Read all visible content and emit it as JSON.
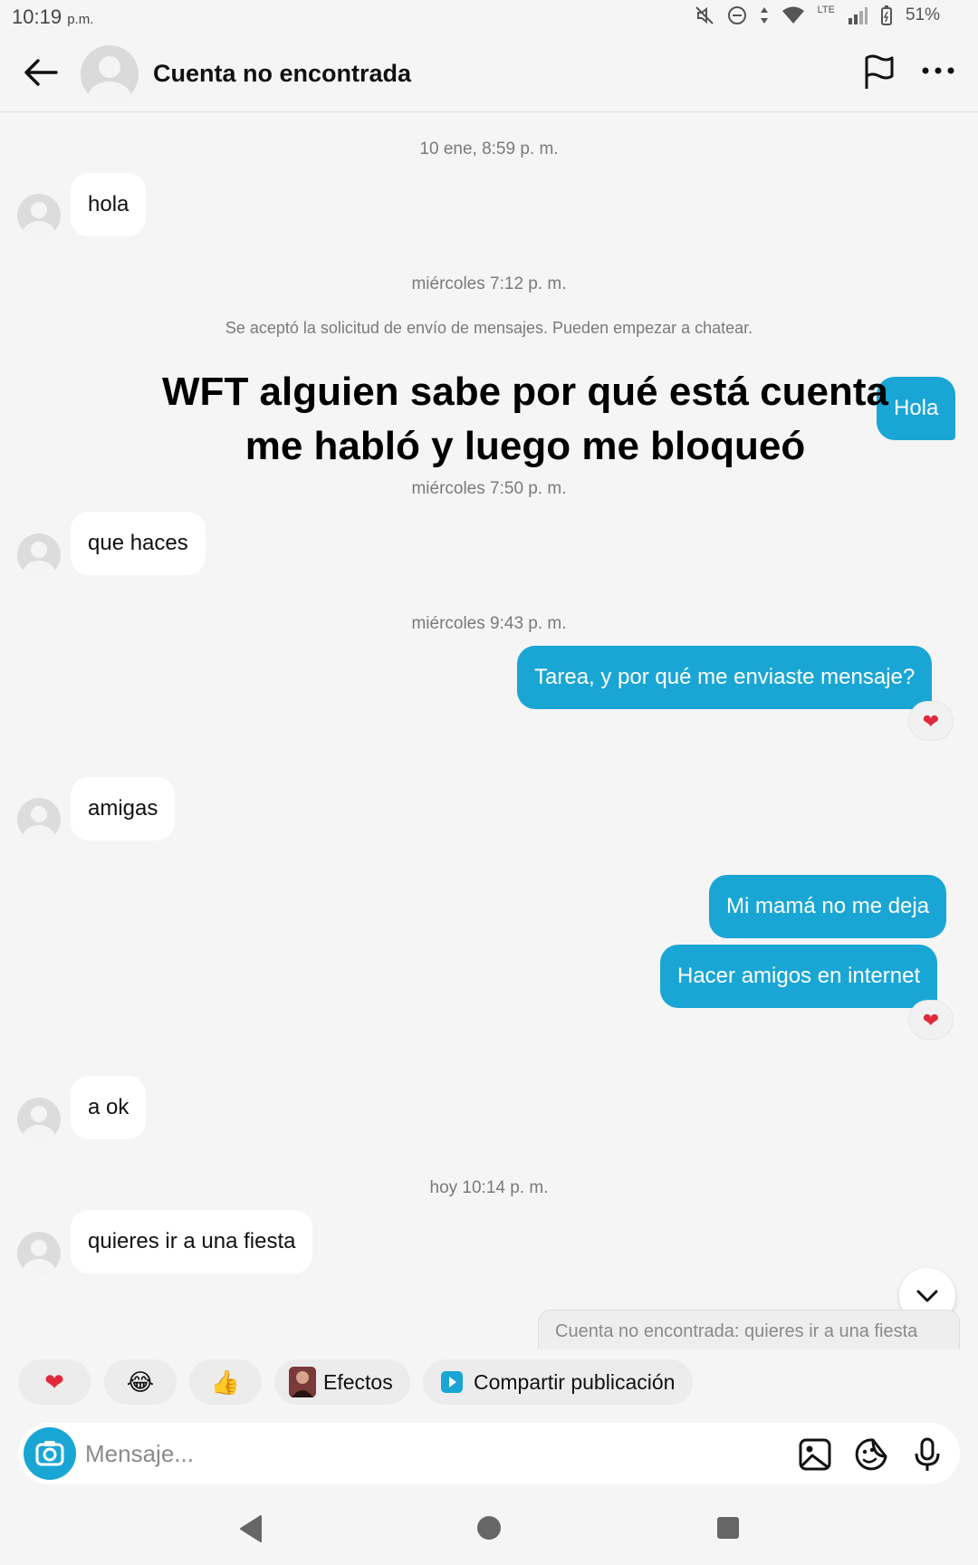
{
  "status_bar": {
    "time": "10:19",
    "ampm": "p.m.",
    "network": "LTE",
    "battery": "51%",
    "icons": [
      "mute-icon",
      "dnd-icon",
      "data-arrows-icon",
      "wifi-icon",
      "signal-icon",
      "battery-icon"
    ]
  },
  "header": {
    "title": "Cuenta no encontrada",
    "icons": [
      "back-arrow-icon",
      "avatar",
      "flag-icon",
      "more-icon"
    ]
  },
  "overlay_text": "WFT alguien sabe por qué está cuenta me habló y luego me bloqueó",
  "thread": {
    "ts1": "10 ene, 8:59 p. m.",
    "msg1": "hola",
    "ts2": "miércoles 7:12 p. m.",
    "system_note": "Se aceptó la solicitud de envío de mensajes. Pueden empezar a chatear.",
    "out1": "Hola",
    "ts3": "miércoles 7:50 p. m.",
    "msg2": "que haces",
    "ts4": "miércoles 9:43 p. m.",
    "out2": "Tarea, y por qué me enviaste mensaje?",
    "reaction1": "❤",
    "msg3": "amigas",
    "out3": "Mi mamá no me deja",
    "out4": "Hacer amigos en internet",
    "reaction2": "❤",
    "msg4": "a ok",
    "ts5": "hoy 10:14 p. m.",
    "msg5": "quieres ir a una fiesta"
  },
  "preview": "Cuenta no encontrada: quieres ir a una fiesta",
  "quick_replies": {
    "heart": "❤",
    "laugh": "😂",
    "thumbs": "👍",
    "effects": "Efectos",
    "share": "Compartir publicación"
  },
  "composer": {
    "placeholder": "Mensaje...",
    "icons": [
      "camera-icon",
      "gallery-icon",
      "sticker-icon",
      "microphone-icon"
    ]
  },
  "colors": {
    "accent": "#1aa6d5",
    "background": "#f5f5f5",
    "bubble_in": "#ffffff"
  }
}
